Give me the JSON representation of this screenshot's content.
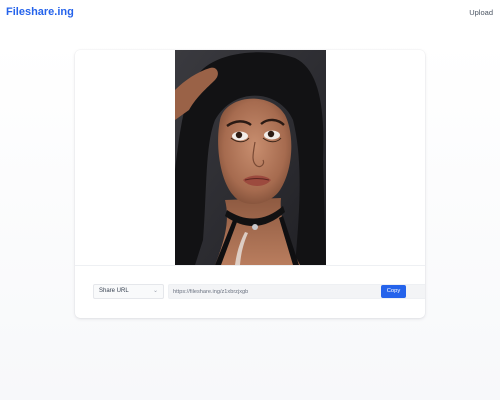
{
  "header": {
    "logo_text": "Fileshare.ing",
    "upload_label": "Upload"
  },
  "share": {
    "select_value": "Share URL",
    "url_value": "https://fileshare.ing/z1xbrzjxgb",
    "copy_label": "Copy"
  },
  "colors": {
    "brand": "#2563eb",
    "page_background": "#f7f8fa",
    "card_background": "#ffffff"
  },
  "icons": {
    "select_chevron": "chevron-down-icon"
  }
}
